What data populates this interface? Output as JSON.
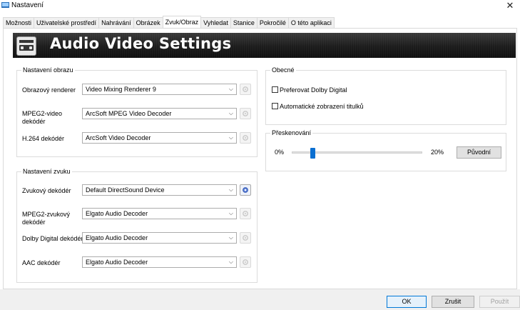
{
  "window": {
    "title": "Nastavení",
    "close_glyph": "✕"
  },
  "tabs": [
    {
      "label": "Možnosti"
    },
    {
      "label": "Uživatelské prostředí"
    },
    {
      "label": "Nahrávání"
    },
    {
      "label": "Obrázek"
    },
    {
      "label": "Zvuk/Obraz",
      "active": true
    },
    {
      "label": "Vyhledat"
    },
    {
      "label": "Stanice"
    },
    {
      "label": "Pokročilé"
    },
    {
      "label": "O této aplikaci"
    }
  ],
  "banner": {
    "title": "Audio Video Settings",
    "icon": "av-device-icon"
  },
  "image_settings": {
    "legend": "Nastavení obrazu",
    "rows": [
      {
        "label": "Obrazový renderer",
        "value": "Video Mixing Renderer 9"
      },
      {
        "label": "MPEG2-video dekódér",
        "value": "ArcSoft MPEG Video Decoder"
      },
      {
        "label": "H.264 dekódér",
        "value": "ArcSoft Video Decoder"
      }
    ]
  },
  "audio_settings": {
    "legend": "Nastavení zvuku",
    "rows": [
      {
        "label": "Zvukový dekódér",
        "value": "Default DirectSound Device"
      },
      {
        "label": "MPEG2-zvukový dekódér",
        "value": "Elgato Audio Decoder"
      },
      {
        "label": "Dolby Digital dekódér",
        "value": "Elgato Audio Decoder"
      },
      {
        "label": "AAC dekódér",
        "value": "Elgato Audio Decoder"
      }
    ]
  },
  "general": {
    "legend": "Obecné",
    "checkboxes": [
      {
        "label": "Preferovat Dolby Digital",
        "checked": false
      },
      {
        "label": "Automatické zobrazení titulků",
        "checked": false
      }
    ]
  },
  "skip": {
    "legend": "Přeskenování",
    "min_label": "0%",
    "max_label": "20%",
    "value_fraction": 0.15,
    "reset_label": "Původní"
  },
  "footer": {
    "ok": "OK",
    "cancel": "Zrušit",
    "apply": "Použít"
  },
  "colors": {
    "accent": "#0078d7",
    "slider": "#0b6fd1",
    "banner": "#1c1c1c"
  }
}
